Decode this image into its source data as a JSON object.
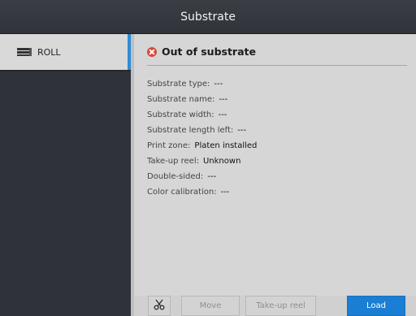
{
  "header": {
    "title": "Substrate"
  },
  "sidebar": {
    "items": [
      {
        "label": "ROLL",
        "icon": "roll-icon",
        "selected": true
      }
    ],
    "accent_color": "#2d8cd4"
  },
  "main": {
    "status": {
      "icon": "error-icon",
      "text": "Out of substrate",
      "color": "#d24a3a"
    },
    "properties": [
      {
        "label": "Substrate type:",
        "value": "---"
      },
      {
        "label": "Substrate name:",
        "value": "---"
      },
      {
        "label": "Substrate width:",
        "value": "---"
      },
      {
        "label": "Substrate length left:",
        "value": "---"
      },
      {
        "label": "Print zone:",
        "value": "Platen installed"
      },
      {
        "label": "Take-up reel:",
        "value": "Unknown"
      },
      {
        "label": "Double-sided:",
        "value": "---"
      },
      {
        "label": "Color calibration:",
        "value": "---"
      }
    ]
  },
  "toolbar": {
    "cut_icon": "scissors-icon",
    "move_label": "Move",
    "takeup_label": "Take-up reel",
    "load_label": "Load",
    "load_color": "#1a7fd4"
  }
}
